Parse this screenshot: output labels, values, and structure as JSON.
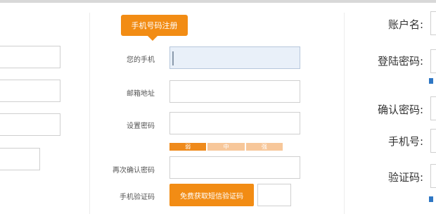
{
  "middle_form": {
    "tab_label": "手机号码注册",
    "phone_label": "您的手机",
    "email_label": "邮箱地址",
    "password_label": "设置密码",
    "strength": {
      "weak": "弱",
      "medium": "中",
      "strong": "强"
    },
    "confirm_label": "再次确认密码",
    "sms_label": "手机验证码",
    "sms_button": "免费获取短信验证码"
  },
  "right_form": {
    "account_label": "账户名:",
    "login_password_label": "登陆密码:",
    "confirm_password_label": "确认密码:",
    "phone_label": "手机号:",
    "captcha_label": "验证码:"
  },
  "colors": {
    "accent": "#f28c14",
    "link_blue": "#2f77c4"
  }
}
